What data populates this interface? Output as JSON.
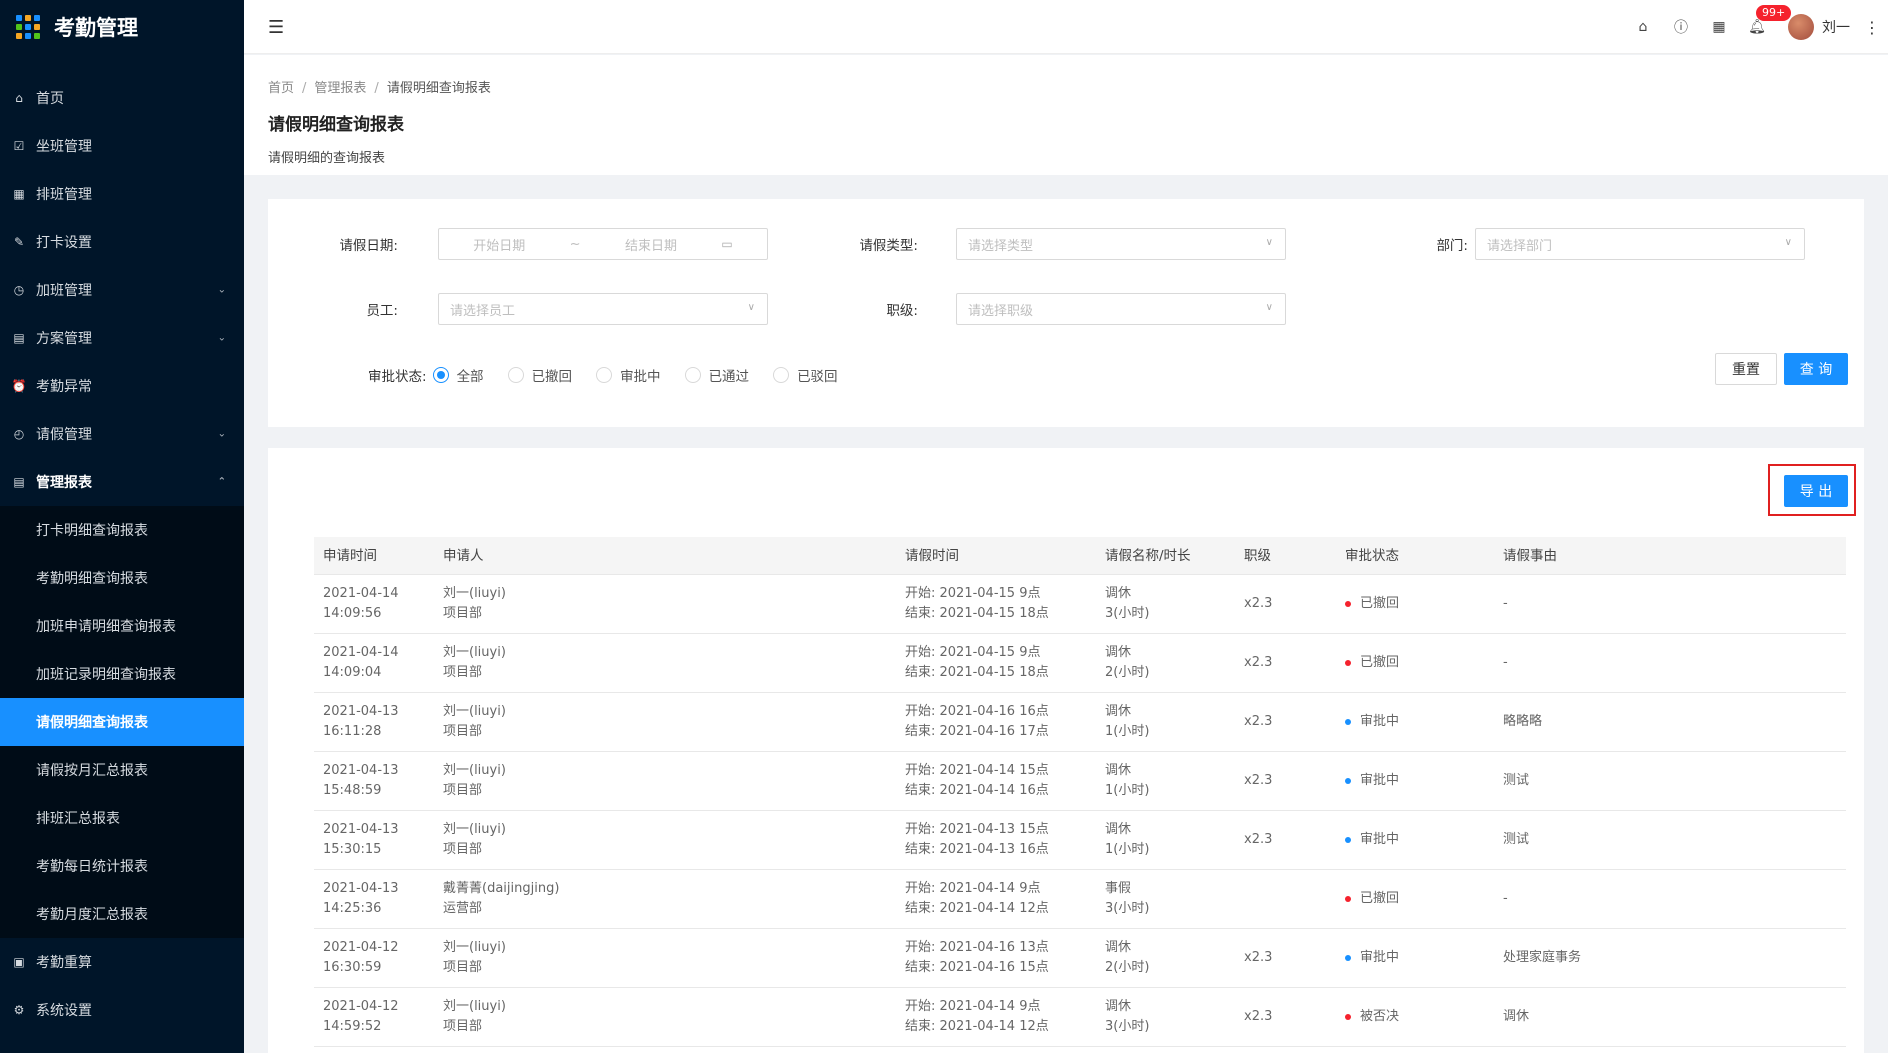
{
  "app": {
    "title": "考勤管理"
  },
  "sidebar": {
    "items": [
      {
        "label": "首页",
        "icon": "home-icon",
        "glyph": "⌂"
      },
      {
        "label": "坐班管理",
        "icon": "calendar-check-icon",
        "glyph": "☑"
      },
      {
        "label": "排班管理",
        "icon": "schedule-icon",
        "glyph": "▦"
      },
      {
        "label": "打卡设置",
        "icon": "edit-icon",
        "glyph": "✎"
      },
      {
        "label": "加班管理",
        "icon": "clock-icon",
        "glyph": "◷",
        "arrow": "⌄"
      },
      {
        "label": "方案管理",
        "icon": "document-icon",
        "glyph": "▤",
        "arrow": "⌄"
      },
      {
        "label": "考勤异常",
        "icon": "alarm-icon",
        "glyph": "⏰"
      },
      {
        "label": "请假管理",
        "icon": "leave-icon",
        "glyph": "◴",
        "arrow": "⌄"
      },
      {
        "label": "管理报表",
        "icon": "report-icon",
        "glyph": "▤",
        "arrow": "⌃"
      }
    ],
    "subitems": [
      "打卡明细查询报表",
      "考勤明细查询报表",
      "加班申请明细查询报表",
      "加班记录明细查询报表",
      "请假明细查询报表",
      "请假按月汇总报表",
      "排班汇总报表",
      "考勤每日统计报表",
      "考勤月度汇总报表"
    ],
    "bottom_items": [
      {
        "label": "考勤重算",
        "icon": "recalculate-icon",
        "glyph": "▣"
      },
      {
        "label": "系统设置",
        "icon": "gear-icon",
        "glyph": "⚙"
      }
    ]
  },
  "header": {
    "badge": "99+",
    "user_name": "刘一"
  },
  "breadcrumb": [
    "首页",
    "管理报表",
    "请假明细查询报表"
  ],
  "page": {
    "title": "请假明细查询报表",
    "description": "请假明细的查询报表"
  },
  "filters": {
    "date_label": "请假日期:",
    "date_start_placeholder": "开始日期",
    "date_sep": "~",
    "date_end_placeholder": "结束日期",
    "type_label": "请假类型:",
    "type_placeholder": "请选择类型",
    "dept_label": "部门:",
    "dept_placeholder": "请选择部门",
    "employee_label": "员工:",
    "employee_placeholder": "请选择员工",
    "level_label": "职级:",
    "level_placeholder": "请选择职级",
    "status_label": "审批状态:",
    "status_options": [
      "全部",
      "已撤回",
      "审批中",
      "已通过",
      "已驳回"
    ],
    "status_selected": "全部",
    "reset_label": "重置",
    "query_label": "查 询"
  },
  "table": {
    "export_label": "导 出",
    "columns": [
      "申请时间",
      "申请人",
      "请假时间",
      "请假名称/时长",
      "职级",
      "审批状态",
      "请假事由"
    ],
    "status_colors": {
      "已撤回": "#f5222d",
      "审批中": "#1890ff",
      "被否决": "#f5222d"
    },
    "rows": [
      {
        "date": "2021-04-14",
        "time": "14:09:56",
        "name": "刘一(liuyi)",
        "dept": "项目部",
        "start": "开始: 2021-04-15 9点",
        "end": "结束: 2021-04-15 18点",
        "leave": "调休",
        "duration": "3(小时)",
        "level": "x2.3",
        "status": "已撤回",
        "reason": "-"
      },
      {
        "date": "2021-04-14",
        "time": "14:09:04",
        "name": "刘一(liuyi)",
        "dept": "项目部",
        "start": "开始: 2021-04-15 9点",
        "end": "结束: 2021-04-15 18点",
        "leave": "调休",
        "duration": "2(小时)",
        "level": "x2.3",
        "status": "已撤回",
        "reason": "-"
      },
      {
        "date": "2021-04-13",
        "time": "16:11:28",
        "name": "刘一(liuyi)",
        "dept": "项目部",
        "start": "开始: 2021-04-16 16点",
        "end": "结束: 2021-04-16 17点",
        "leave": "调休",
        "duration": "1(小时)",
        "level": "x2.3",
        "status": "审批中",
        "reason": "略略略"
      },
      {
        "date": "2021-04-13",
        "time": "15:48:59",
        "name": "刘一(liuyi)",
        "dept": "项目部",
        "start": "开始: 2021-04-14 15点",
        "end": "结束: 2021-04-14 16点",
        "leave": "调休",
        "duration": "1(小时)",
        "level": "x2.3",
        "status": "审批中",
        "reason": "测试"
      },
      {
        "date": "2021-04-13",
        "time": "15:30:15",
        "name": "刘一(liuyi)",
        "dept": "项目部",
        "start": "开始: 2021-04-13 15点",
        "end": "结束: 2021-04-13 16点",
        "leave": "调休",
        "duration": "1(小时)",
        "level": "x2.3",
        "status": "审批中",
        "reason": "测试"
      },
      {
        "date": "2021-04-13",
        "time": "14:25:36",
        "name": "戴菁菁(daijingjing)",
        "dept": "运营部",
        "start": "开始: 2021-04-14 9点",
        "end": "结束: 2021-04-14 12点",
        "leave": "事假",
        "duration": "3(小时)",
        "level": "",
        "status": "已撤回",
        "reason": "-"
      },
      {
        "date": "2021-04-12",
        "time": "16:30:59",
        "name": "刘一(liuyi)",
        "dept": "项目部",
        "start": "开始: 2021-04-16 13点",
        "end": "结束: 2021-04-16 15点",
        "leave": "调休",
        "duration": "2(小时)",
        "level": "x2.3",
        "status": "审批中",
        "reason": "处理家庭事务"
      },
      {
        "date": "2021-04-12",
        "time": "14:59:52",
        "name": "刘一(liuyi)",
        "dept": "项目部",
        "start": "开始: 2021-04-14 9点",
        "end": "结束: 2021-04-14 12点",
        "leave": "调休",
        "duration": "3(小时)",
        "level": "x2.3",
        "status": "被否决",
        "reason": "调休"
      }
    ]
  }
}
